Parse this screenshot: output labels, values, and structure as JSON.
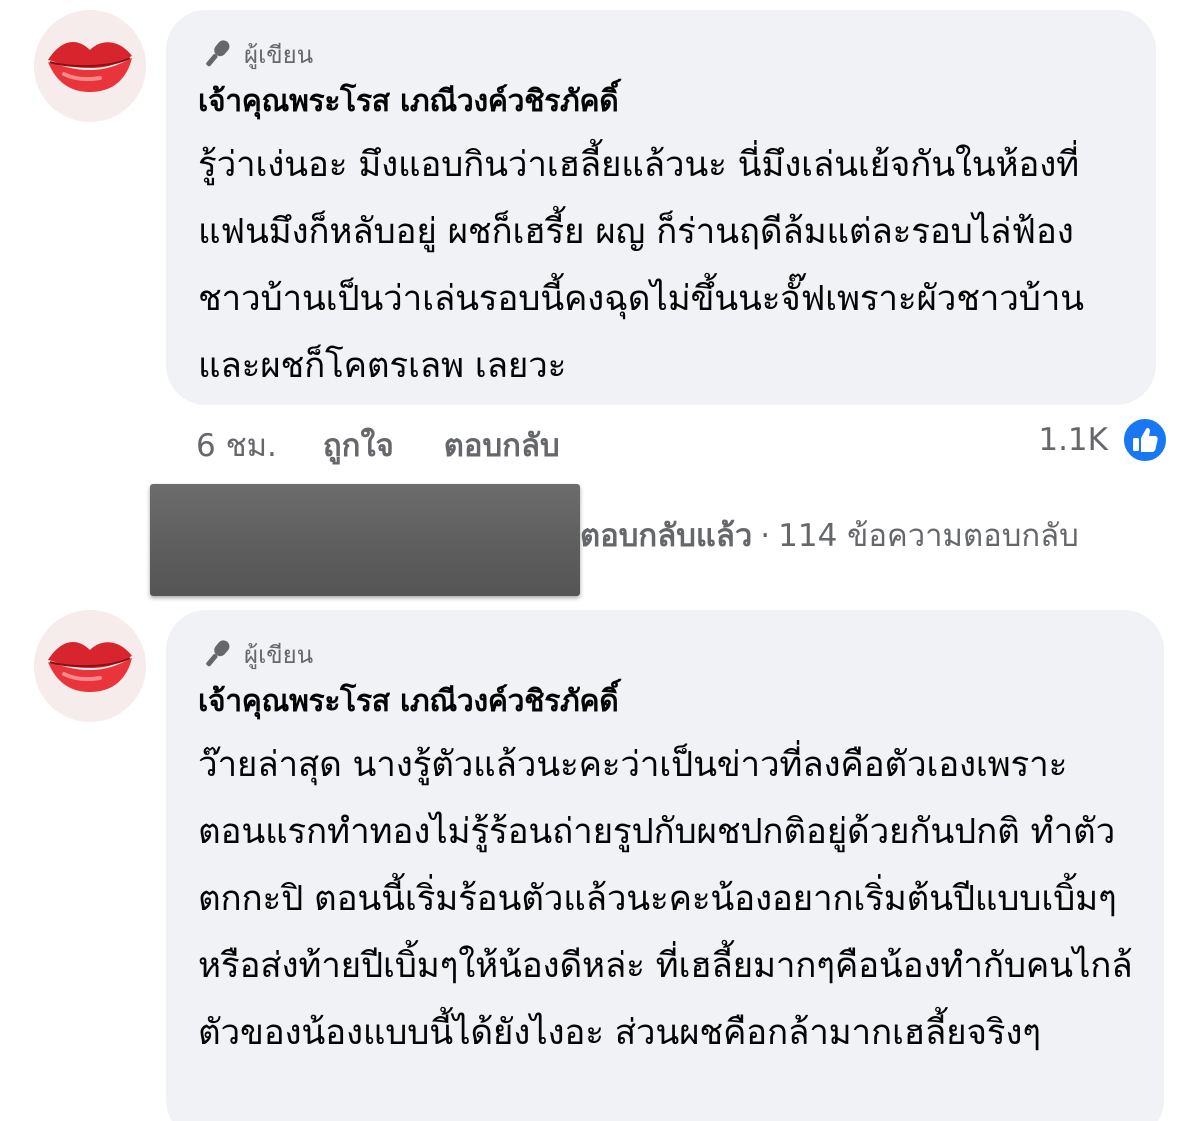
{
  "comments": [
    {
      "author_badge": "ผู้เขียน",
      "author_name": "เจ้าคุณพระโรส เภณีวงค์วชิรภัคดิ์",
      "text": "รู้ว่าเง่นอะ มึงแอบกินว่าเฮลี้ยแล้วนะ นี่มึงเล่นเย้จกันในห้องที่แฟนมึงก็หลับอยู่ ผชก็เฮรี้ย ผญ ก็ร่านฤดีล้มแต่ละรอบไล่ฟ้องชาวบ้านเป็นว่าเล่นรอบนี้คงฉุดไม่ขึ้นนะจั๊ฟเพราะผัวชาวบ้าน และผชก็โคตรเลพ เลยวะ",
      "time": "6 ชม.",
      "like_label": "ถูกใจ",
      "reply_label": "ตอบกลับ",
      "reaction_count": "1.1K",
      "reaction_icon": "like-thumbs-up-icon"
    },
    {
      "author_badge": "ผู้เขียน",
      "author_name": "เจ้าคุณพระโรส เภณีวงค์วชิรภัคดิ์",
      "text": "ว๊ายล่าสุด นางรู้ตัวแล้วนะคะว่าเป็นข่าวที่ลงคือตัวเองเพราะตอนแรกทำทองไม่รู้ร้อนถ่ายรูปกับผชปกติอยู่ด้วยกันปกติ ทำตัวตกกะปิ ตอนนี้เริ่มร้อนตัวแล้วนะคะน้องอยากเริ่มต้นปีแบบเบิ้มๆหรือส่งท้ายปีเบิ้มๆให้น้องดีหล่ะ ที่เฮลี้ยมากๆคือน้องทำกับคนไกล้ตัวของน้องแบบนี้ได้ยังไงอะ ส่วนผชคือกล้ามากเฮลี้ยจริงๆ"
    }
  ],
  "reply_summary": {
    "replied": "ตอบกลับแล้ว",
    "separator": "·",
    "count": "114 ข้อความตอบกลับ"
  },
  "colors": {
    "bubble": "#f0f2f5",
    "secondary_text": "#65676b",
    "like_blue": "#1877f2"
  }
}
